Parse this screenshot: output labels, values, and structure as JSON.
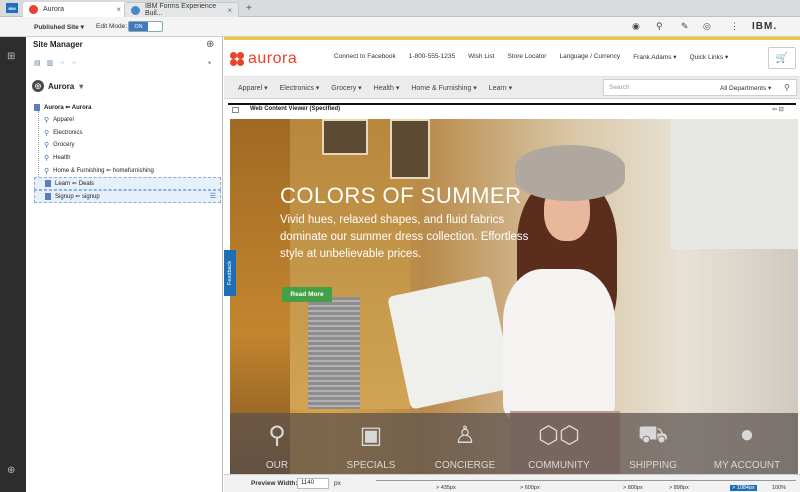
{
  "browser": {
    "tabs": [
      {
        "label": "Aurora",
        "active": true
      },
      {
        "label": "IBM Forms Experience Buil...",
        "active": false
      }
    ],
    "new_tab": "+"
  },
  "admin_bar": {
    "published_site": "Published Site ▾",
    "edit_mode_label": "Edit Mode:",
    "edit_mode_value": "ON",
    "brand": "IBM."
  },
  "site_manager": {
    "title": "Site Manager",
    "site_name": "Aurora",
    "root": "Aurora ⇐ Aurora",
    "items": [
      {
        "label": "Apparel",
        "type": "link"
      },
      {
        "label": "Electronics",
        "type": "link"
      },
      {
        "label": "Grocery",
        "type": "link"
      },
      {
        "label": "Health",
        "type": "link"
      },
      {
        "label": "Home & Furnishing ⇐ homefurnishing",
        "type": "link"
      },
      {
        "label": "Learn ⇐ Deals",
        "type": "page"
      },
      {
        "label": "Signup ⇐ signup",
        "type": "page"
      }
    ]
  },
  "store": {
    "logo": "aurora",
    "header_links": [
      "Connect to Facebook",
      "1-800-555-1235",
      "Wish List",
      "Store Locator",
      "Language / Currency",
      "Frank Adams ▾",
      "Quick Links ▾"
    ],
    "nav": [
      "Apparel ▾",
      "Electronics ▾",
      "Grocery ▾",
      "Health ▾",
      "Home & Furnishing ▾",
      "Learn ▾"
    ],
    "search_placeholder": "Search",
    "search_dept": "All Departments ▾",
    "wcv_label": "Web Content Viewer (Specified)",
    "hero": {
      "headline": "COLORS OF SUMMER",
      "subtext": "Vivid hues, relaxed shapes, and fluid fabrics dominate our summer dress collection. Effortless style at unbelievable prices.",
      "button": "Read More"
    },
    "icon_bar": [
      {
        "label": "OUR",
        "icon": "map-pin-icon"
      },
      {
        "label": "SPECIALS",
        "icon": "money-icon"
      },
      {
        "label": "CONCIERGE",
        "icon": "person-icon"
      },
      {
        "label": "COMMUNITY",
        "icon": "hexagons-icon"
      },
      {
        "label": "SHIPPING",
        "icon": "truck-icon"
      },
      {
        "label": "MY ACCOUNT",
        "icon": "user-icon"
      }
    ],
    "feedback": "Feedback"
  },
  "preview": {
    "label": "Preview Width:",
    "value": "1140",
    "unit": "px",
    "breakpoints": [
      "> 435px",
      "> 600px",
      "> 800px",
      "> 898px",
      "> 1084px",
      "100%"
    ],
    "active_breakpoint": "> 1084px"
  }
}
